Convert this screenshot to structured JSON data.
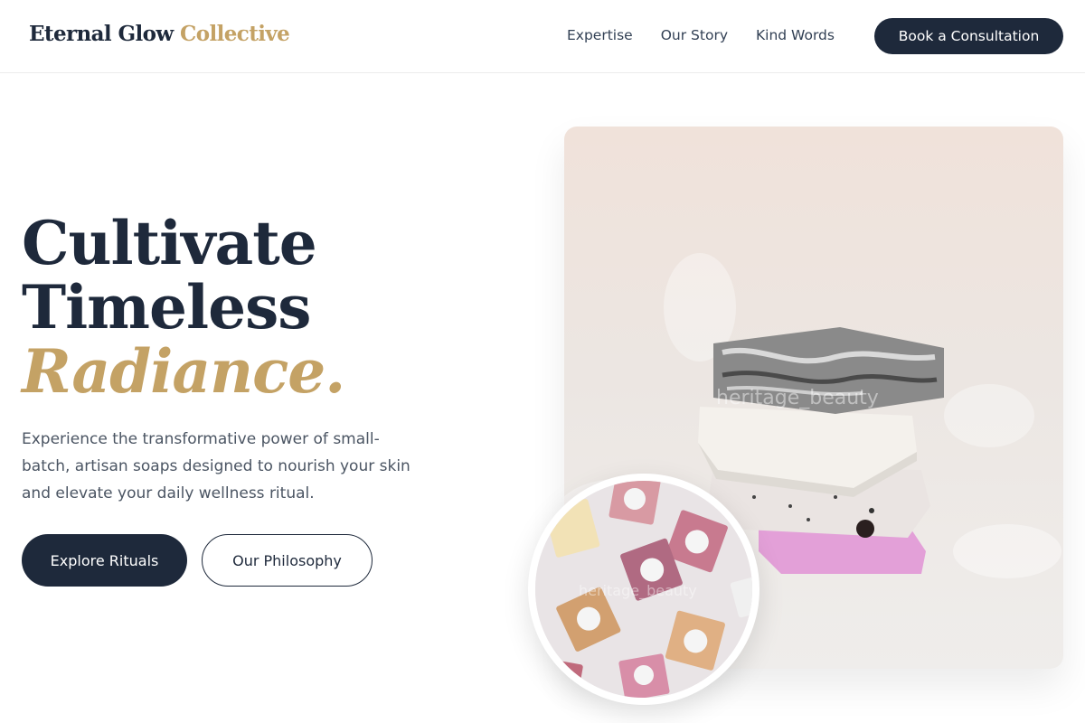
{
  "header": {
    "logo_main": "Eternal Glow",
    "logo_accent": "Collective",
    "nav": [
      "Expertise",
      "Our Story",
      "Kind Words"
    ],
    "cta_label": "Book a Consultation"
  },
  "hero": {
    "headline_line1": "Cultivate",
    "headline_line2": "Timeless",
    "headline_accent": "Radiance.",
    "description": "Experience the transformative power of small-batch, artisan soaps designed to nourish your skin and elevate your daily wellness ritual.",
    "primary_button": "Explore Rituals",
    "secondary_button": "Our Philosophy"
  },
  "images": {
    "main_watermark": "heritage_beauty",
    "circle_watermark": "heritage_beauty"
  },
  "colors": {
    "navy": "#1e293b",
    "gold": "#c4a265"
  }
}
